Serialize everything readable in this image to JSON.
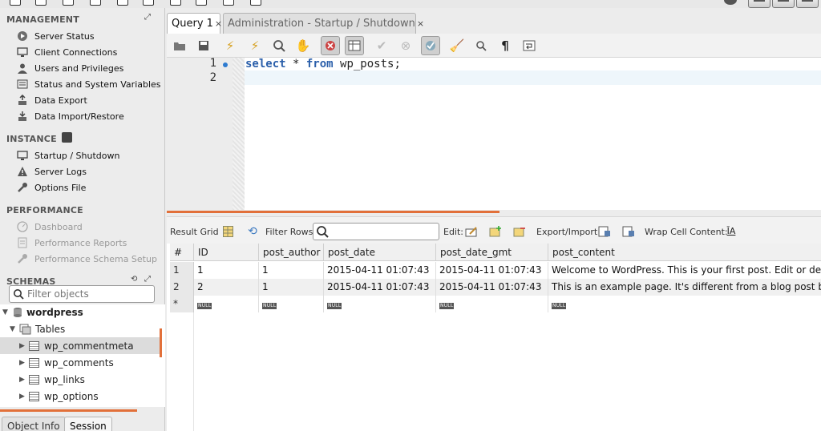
{
  "sidebar": {
    "management": {
      "title": "MANAGEMENT",
      "items": [
        "Server Status",
        "Client Connections",
        "Users and Privileges",
        "Status and System Variables",
        "Data Export",
        "Data Import/Restore"
      ]
    },
    "instance": {
      "title": "INSTANCE",
      "items": [
        "Startup / Shutdown",
        "Server Logs",
        "Options File"
      ]
    },
    "performance": {
      "title": "PERFORMANCE",
      "items": [
        "Dashboard",
        "Performance Reports",
        "Performance Schema Setup"
      ]
    },
    "schemas": {
      "title": "SCHEMAS",
      "filter_placeholder": "Filter objects",
      "schema_name": "wordpress",
      "tables_label": "Tables",
      "tables": [
        "wp_commentmeta",
        "wp_comments",
        "wp_links",
        "wp_options"
      ]
    },
    "bottom_tabs": [
      "Object Info",
      "Session"
    ]
  },
  "tabs": [
    {
      "label": "Query 1",
      "close": "×"
    },
    {
      "label": "Administration - Startup / Shutdown",
      "close": "×"
    }
  ],
  "editor": {
    "line_numbers": [
      "1",
      "2"
    ],
    "sql": {
      "kw1": "select",
      "mid": " * ",
      "kw2": "from",
      "rest": " wp_posts;"
    }
  },
  "results_toolbar": {
    "result_grid": "Result Grid",
    "filter_rows": "Filter Rows:",
    "edit": "Edit:",
    "export_import": "Export/Import:",
    "wrap_cell": "Wrap Cell Content:"
  },
  "grid": {
    "columns": [
      "#",
      "ID",
      "post_author",
      "post_date",
      "post_date_gmt",
      "post_content"
    ],
    "rows": [
      [
        "1",
        "1",
        "1",
        "2015-04-11 01:07:43",
        "2015-04-11 01:07:43",
        "Welcome to WordPress. This is your first post. Edit or de"
      ],
      [
        "2",
        "2",
        "1",
        "2015-04-11 01:07:43",
        "2015-04-11 01:07:43",
        "This is an example page. It's different from a blog post b"
      ]
    ],
    "new_row_marker": "*",
    "null_label": "NULL"
  },
  "colors": {
    "accent": "#e2703a",
    "keyword": "#2b5faa"
  }
}
